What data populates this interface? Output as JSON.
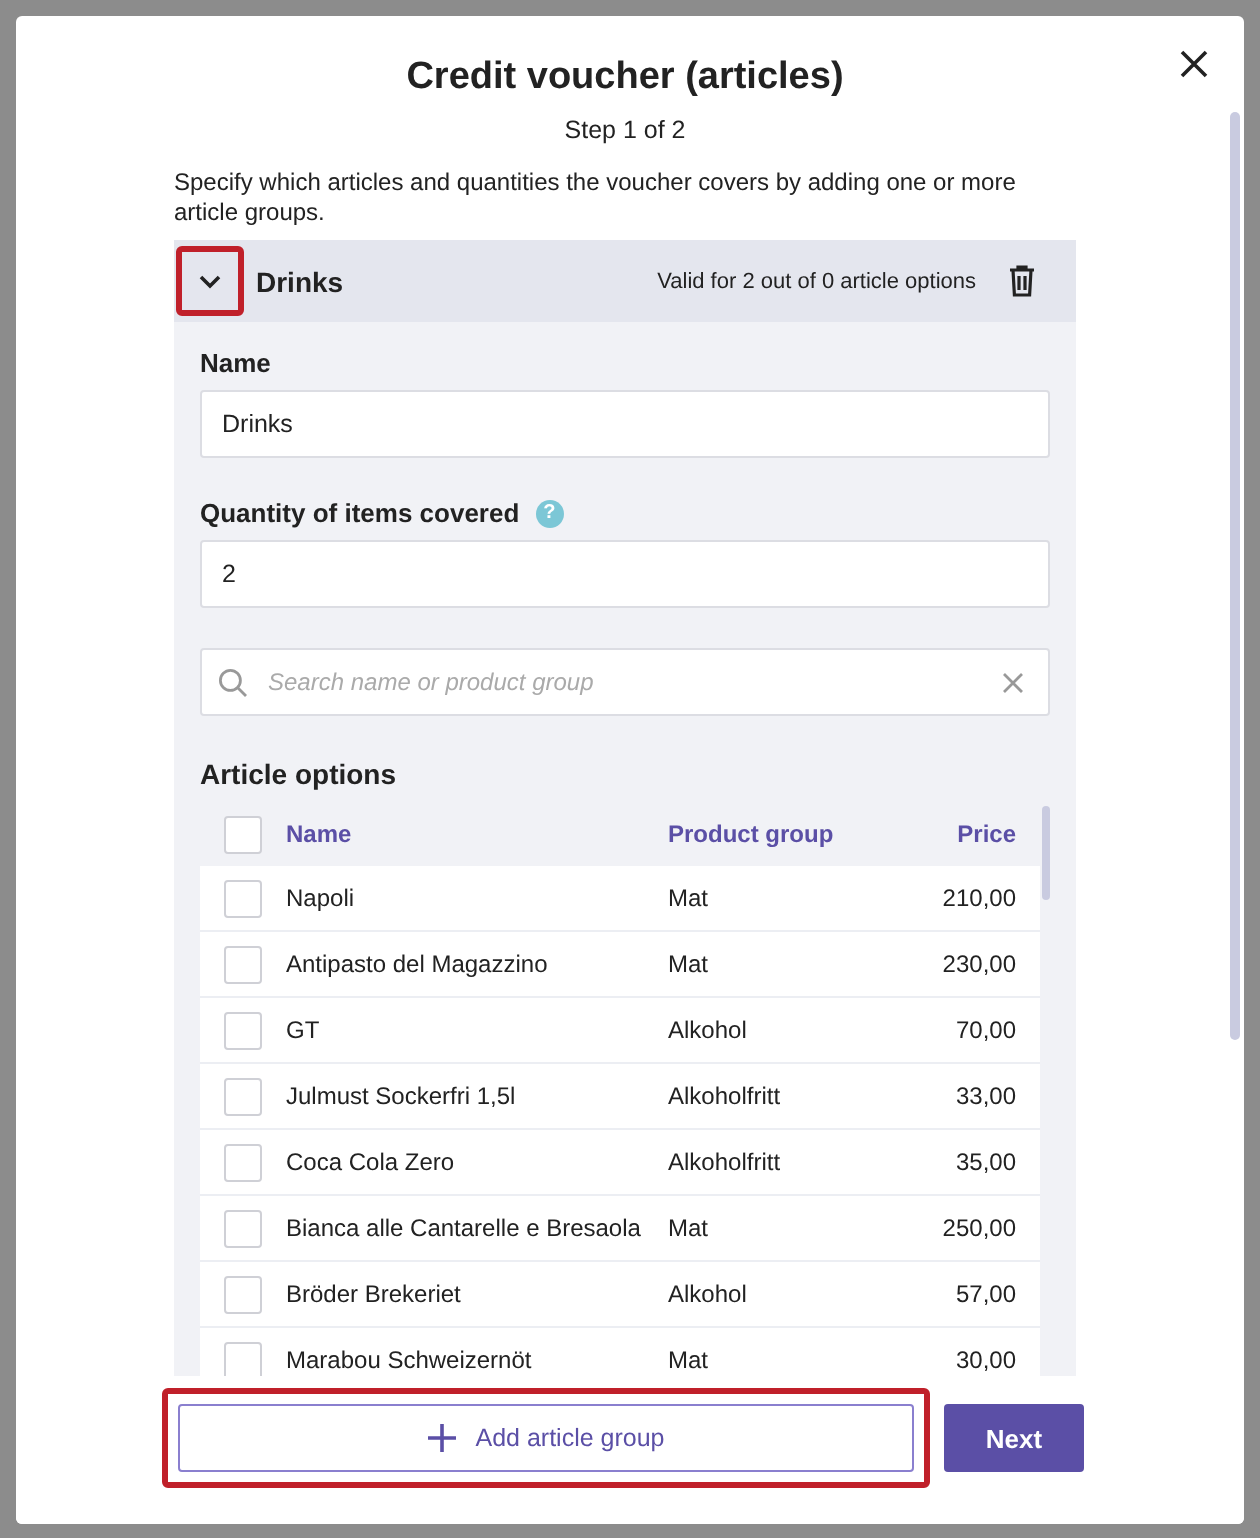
{
  "dialog": {
    "title": "Credit voucher (articles)",
    "step": "Step 1 of 2",
    "description": "Specify which articles and quantities the voucher covers by adding one or more article groups.",
    "article_groups": [
      {
        "name": "Drinks",
        "expanded": true,
        "highlighted": true,
        "validity": "Valid for 2 out of 0 article options",
        "fields": [
          {
            "label": "Name",
            "value": "Drinks"
          },
          {
            "label": "Quantity of items covered",
            "value": "2",
            "help": "?"
          }
        ],
        "search": {
          "placeholder": "Search name or product group"
        },
        "options_title": "Article options",
        "columns": [
          "Name",
          "Product group",
          "Price"
        ],
        "select_all_checked": false,
        "rows": [
          {
            "name": "Napoli",
            "group": "Mat",
            "price": "210,00",
            "checked": false
          },
          {
            "name": "Antipasto del Magazzino",
            "group": "Mat",
            "price": "230,00",
            "checked": false
          },
          {
            "name": "GT",
            "group": "Alkohol",
            "price": "70,00",
            "checked": false
          },
          {
            "name": "Julmust Sockerfri 1,5l",
            "group": "Alkoholfritt",
            "price": "33,00",
            "checked": false
          },
          {
            "name": "Coca Cola Zero",
            "group": "Alkoholfritt",
            "price": "35,00",
            "checked": false
          },
          {
            "name": "Bianca alle Cantarelle e Bresaola",
            "group": "Mat",
            "price": "250,00",
            "checked": false
          },
          {
            "name": "Bröder Brekeriet",
            "group": "Alkohol",
            "price": "57,00",
            "checked": false
          },
          {
            "name": "Marabou Schweizernöt",
            "group": "Mat",
            "price": "30,00",
            "checked": false
          }
        ]
      }
    ],
    "add_button": {
      "label": "Add article group",
      "highlighted": true
    },
    "next_button": "Next"
  }
}
